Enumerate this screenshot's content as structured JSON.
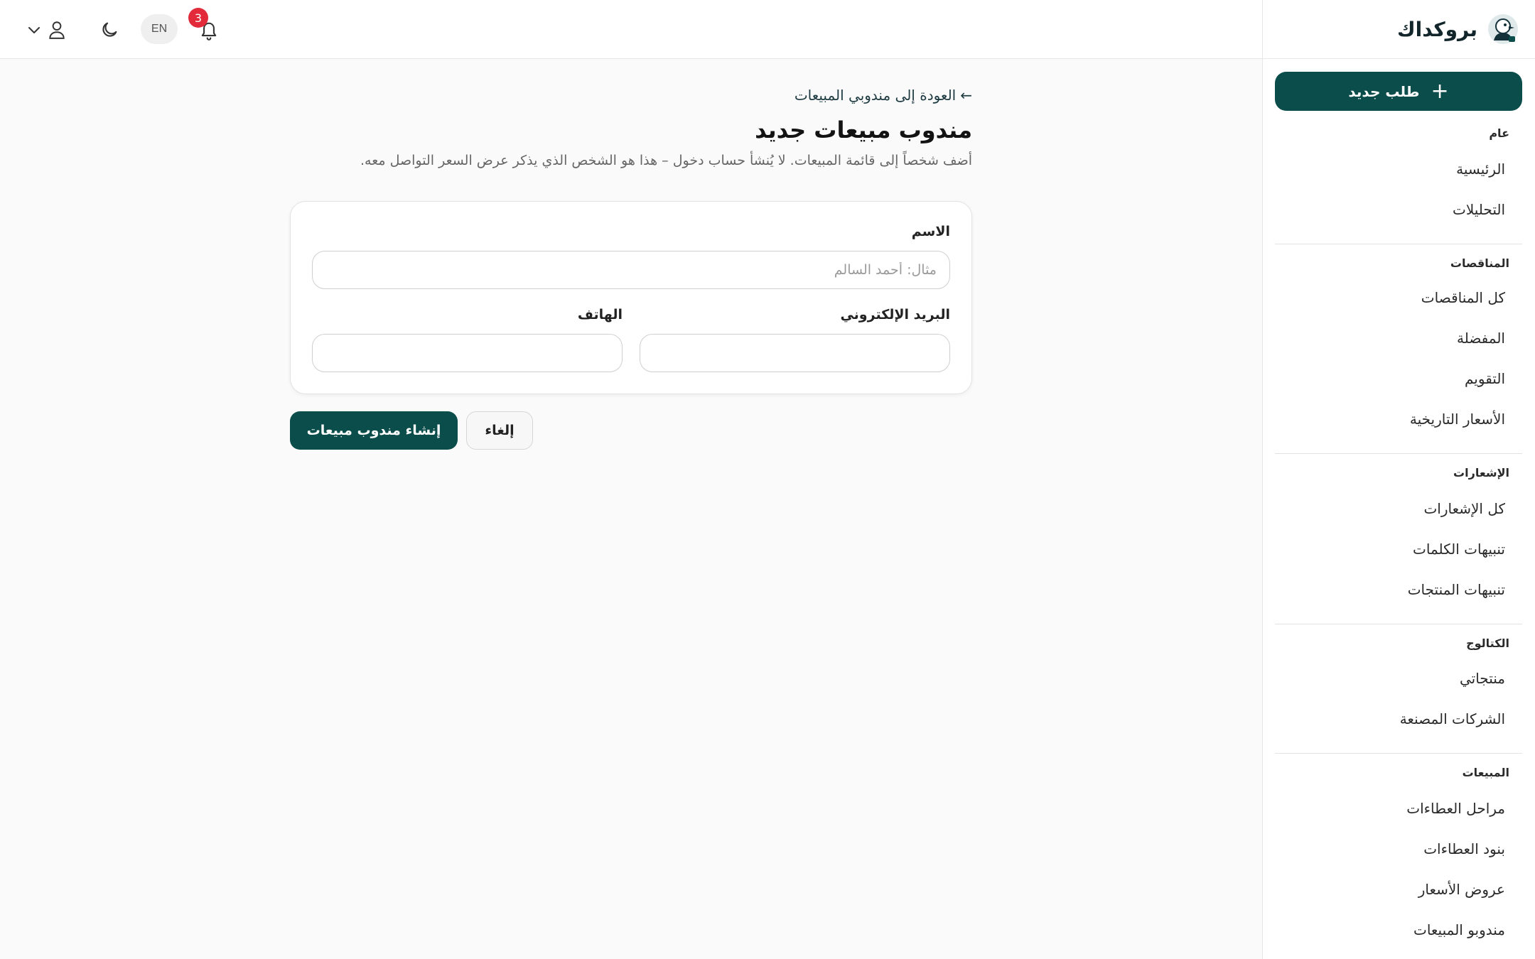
{
  "brand": {
    "name": "بروكداك",
    "logo_icon": "duck-logo-icon"
  },
  "sidebar": {
    "new_request_label": "طلب جديد",
    "sections": [
      {
        "title": "عام",
        "items": [
          "الرئيسية",
          "التحليلات"
        ]
      },
      {
        "title": "المناقصات",
        "items": [
          "كل المناقصات",
          "المفضلة",
          "التقويم",
          "الأسعار التاريخية"
        ]
      },
      {
        "title": "الإشعارات",
        "items": [
          "كل الإشعارات",
          "تنبيهات الكلمات",
          "تنبيهات المنتجات"
        ]
      },
      {
        "title": "الكتالوج",
        "items": [
          "منتجاتي",
          "الشركات المصنعة"
        ]
      },
      {
        "title": "المبيعات",
        "items": [
          "مراحل العطاءات",
          "بنود العطاءات",
          "عروض الأسعار",
          "مندوبو المبيعات"
        ]
      }
    ]
  },
  "topbar": {
    "notification_count": "3",
    "language": "EN",
    "icons": [
      "bell-icon",
      "moon-icon",
      "user-icon",
      "chevron-down-icon"
    ]
  },
  "page": {
    "back_link": "العودة إلى مندوبي المبيعات",
    "back_arrow": "←",
    "title": "مندوب مبيعات جديد",
    "subtitle": "أضف شخصاً إلى قائمة المبيعات. لا يُنشأ حساب دخول – هذا هو الشخص الذي يذكر عرض السعر التواصل معه."
  },
  "form": {
    "name_label": "الاسم",
    "name_placeholder": "مثال: أحمد السالم",
    "name_value": "",
    "email_label": "البريد الإلكتروني",
    "email_value": "",
    "phone_label": "الهاتف",
    "phone_value": ""
  },
  "actions": {
    "create_label": "إنشاء مندوب مبيعات",
    "cancel_label": "إلغاء"
  },
  "colors": {
    "primary": "#0b4d4b",
    "badge": "#e32a3a",
    "background": "#fafafa"
  }
}
